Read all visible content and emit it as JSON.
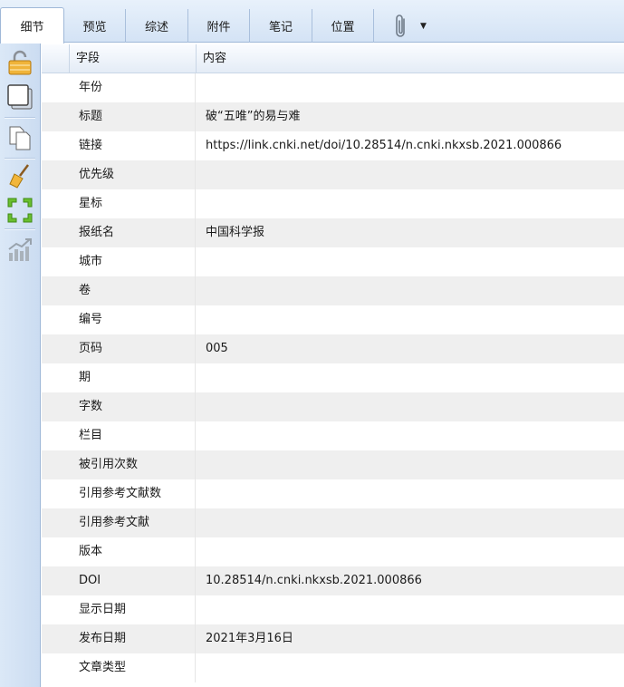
{
  "tabs": [
    {
      "label": "细节",
      "active": true
    },
    {
      "label": "预览",
      "active": false
    },
    {
      "label": "综述",
      "active": false
    },
    {
      "label": "附件",
      "active": false
    },
    {
      "label": "笔记",
      "active": false
    },
    {
      "label": "位置",
      "active": false
    }
  ],
  "attach_menu_icon": "paperclip-icon",
  "toolbar_icons": [
    "lock-open-icon",
    "window-icon",
    "copy-icon",
    "broom-icon",
    "fit-arrows-icon",
    "chart-trend-icon"
  ],
  "colors": {
    "accent": "#d4e3f5",
    "row_alt": "#efefef",
    "border": "#9fb8d8"
  },
  "grid": {
    "header": {
      "field": "字段",
      "content": "内容"
    },
    "rows": [
      {
        "field": "年份",
        "value": ""
      },
      {
        "field": "标题",
        "value": "破“五唯”的易与难"
      },
      {
        "field": "链接",
        "value": "https://link.cnki.net/doi/10.28514/n.cnki.nkxsb.2021.000866"
      },
      {
        "field": "优先级",
        "value": ""
      },
      {
        "field": "星标",
        "value": ""
      },
      {
        "field": "报纸名",
        "value": "中国科学报"
      },
      {
        "field": "城市",
        "value": ""
      },
      {
        "field": "卷",
        "value": ""
      },
      {
        "field": "编号",
        "value": ""
      },
      {
        "field": "页码",
        "value": "005"
      },
      {
        "field": "期",
        "value": ""
      },
      {
        "field": "字数",
        "value": ""
      },
      {
        "field": "栏目",
        "value": ""
      },
      {
        "field": "被引用次数",
        "value": ""
      },
      {
        "field": "引用参考文献数",
        "value": ""
      },
      {
        "field": "引用参考文献",
        "value": ""
      },
      {
        "field": "版本",
        "value": ""
      },
      {
        "field": "DOI",
        "value": "10.28514/n.cnki.nkxsb.2021.000866"
      },
      {
        "field": "显示日期",
        "value": ""
      },
      {
        "field": "发布日期",
        "value": "2021年3月16日"
      },
      {
        "field": "文章类型",
        "value": ""
      }
    ]
  }
}
